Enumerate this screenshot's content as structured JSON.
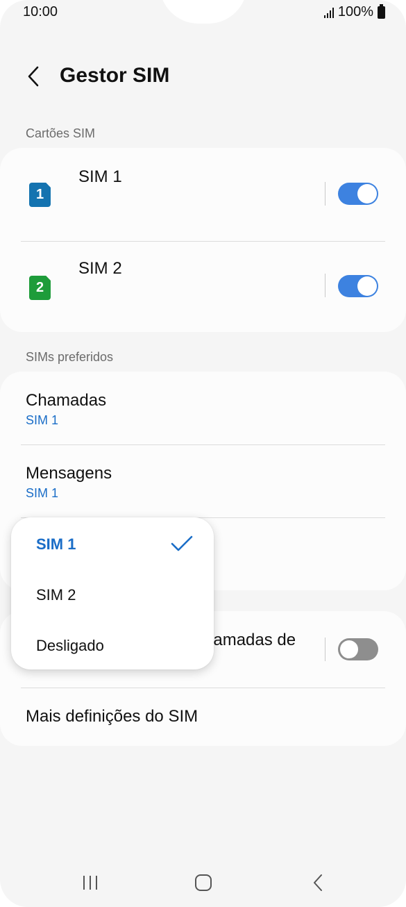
{
  "status": {
    "time": "10:00",
    "battery": "100%"
  },
  "header": {
    "title": "Gestor SIM"
  },
  "sim_cards": {
    "section_label": "Cartões SIM",
    "items": [
      {
        "badge": "1",
        "name": "SIM 1",
        "color": "#1473b0",
        "enabled": true
      },
      {
        "badge": "2",
        "name": "SIM 2",
        "color": "#1e9c3a",
        "enabled": true
      }
    ]
  },
  "preferred": {
    "section_label": "SIMs preferidos",
    "calls": {
      "title": "Chamadas",
      "value": "SIM 1"
    },
    "messages": {
      "title": "Mensagens",
      "value": "SIM 1"
    }
  },
  "other": {
    "partial_title": "hamadas de",
    "dual_toggle_enabled": false,
    "more_settings": "Mais definições do SIM"
  },
  "popup": {
    "options": [
      {
        "label": "SIM 1",
        "selected": true
      },
      {
        "label": "SIM 2",
        "selected": false
      },
      {
        "label": "Desligado",
        "selected": false
      }
    ]
  },
  "colors": {
    "accent": "#1a6dc7",
    "toggle_on": "#3d82e0",
    "sim1": "#1473b0",
    "sim2": "#1e9c3a"
  }
}
